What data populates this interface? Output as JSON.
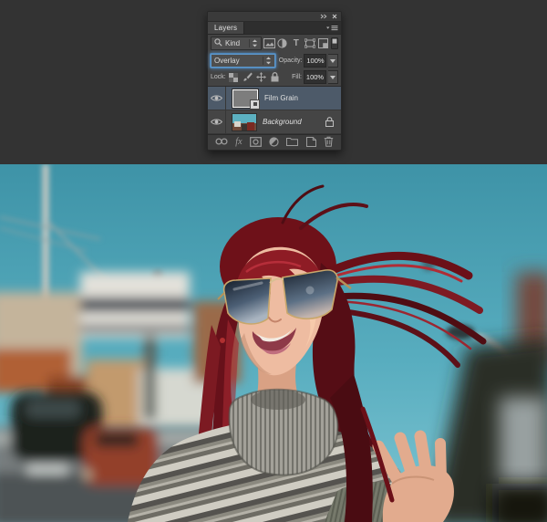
{
  "workspace": {
    "background_color": "#333333"
  },
  "layers_panel": {
    "tab_label": "Layers",
    "window_icons": [
      "collapse-panel-icon",
      "close-panel-icon"
    ],
    "filter_bar": {
      "search_icon": "search-icon",
      "kind_label": "Kind",
      "type_icon_glyph": "T",
      "type_icons": [
        "pixel-layer-filter-icon",
        "adjustment-layer-filter-icon",
        "type-layer-filter-icon",
        "shape-layer-filter-icon",
        "smart-object-filter-icon"
      ],
      "toggle_icon": "layer-filter-toggle-icon"
    },
    "blend_mode": {
      "value": "Overlay",
      "focused": true,
      "focus_color": "#5e97c9"
    },
    "opacity": {
      "label": "Opacity:",
      "value": "100%"
    },
    "lock_bar": {
      "label": "Lock:",
      "icons": [
        "lock-transparency-icon",
        "lock-pixels-icon",
        "lock-position-icon",
        "lock-all-icon"
      ]
    },
    "fill": {
      "label": "Fill:",
      "value": "100%"
    },
    "layers": [
      {
        "name": "Film Grain",
        "selected": true,
        "visible": true,
        "locked": false,
        "thumbnail": "gray-grain-swatch",
        "selected_bg": "#4d5a69"
      },
      {
        "name": "Background",
        "selected": false,
        "visible": true,
        "locked": true,
        "italic": true,
        "thumbnail": "street-photo-mini"
      }
    ],
    "bottom_bar": {
      "fx_label": "fx",
      "icons": [
        "link-layers-icon",
        "layer-style-icon",
        "layer-mask-icon",
        "adjustment-fill-icon",
        "new-group-icon",
        "new-layer-icon",
        "delete-layer-icon"
      ]
    }
  },
  "photo": {
    "alt": "Smiling woman with flowing red hair, gradient sunglasses and striped turtleneck, looking up on a blurred sunny street",
    "colors": {
      "sky_top": "#3e93a7",
      "sky_bottom": "#7fc5d2",
      "hair": "#6e1119",
      "hair_highlight": "#b02c35",
      "skin": "#eebca1",
      "sweater_light": "#cfccc2",
      "sweater_dark": "#55534f",
      "road": "#777d7e",
      "roof_orange": "#b06036",
      "car_red": "#93402a",
      "lamp_pole": "#b8c4c6"
    }
  }
}
